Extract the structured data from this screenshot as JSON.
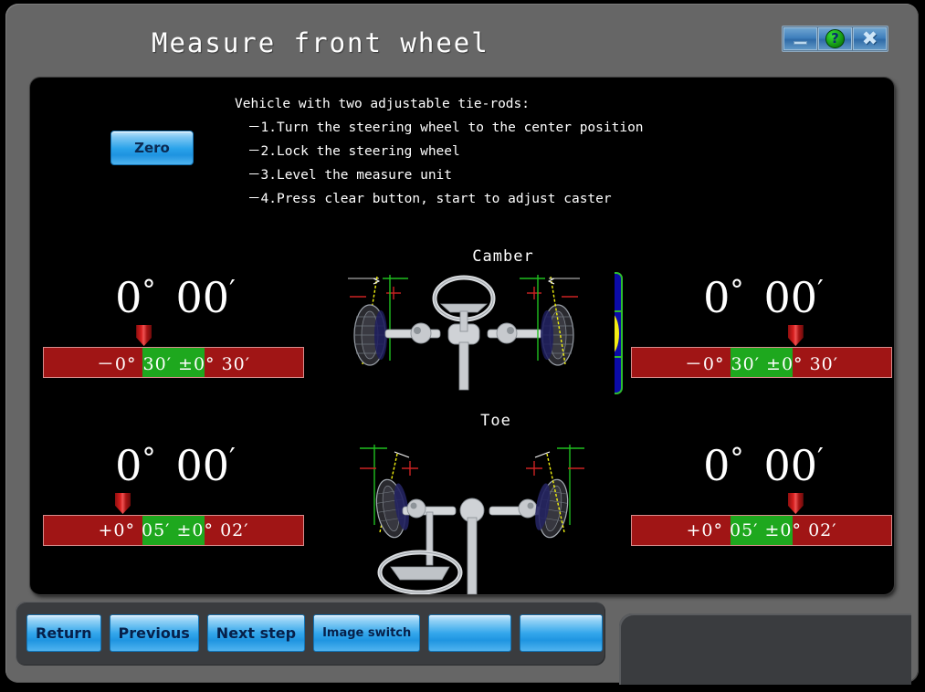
{
  "window": {
    "title": "Measure front wheel",
    "controls": [
      {
        "name": "minimize-button",
        "glyph": "minimize"
      },
      {
        "name": "help-button",
        "glyph": "?"
      },
      {
        "name": "close-button",
        "glyph": "✖"
      }
    ]
  },
  "instructions": {
    "heading": "Vehicle with two adjustable tie-rods:",
    "steps": [
      "－1.Turn the steering wheel to the center position",
      "－2.Lock the steering wheel",
      "－3.Level the measure unit",
      "－4.Press clear button, start to adjust caster"
    ]
  },
  "zero_button": {
    "label": "Zero"
  },
  "sections": {
    "camber_label": "Camber",
    "toe_label": "Toe"
  },
  "readouts": {
    "camber_left": {
      "degrees": "0",
      "deg_symbol": "°",
      "minutes": "00",
      "min_symbol": "′",
      "spec_text": "－0° 30′ ±0° 30′",
      "green_left_pct": 38,
      "green_width_pct": 24,
      "pointer_pct": 38
    },
    "camber_right": {
      "degrees": "0",
      "deg_symbol": "°",
      "minutes": "00",
      "min_symbol": "′",
      "spec_text": "－0° 30′ ±0° 30′",
      "green_left_pct": 38,
      "green_width_pct": 24,
      "pointer_pct": 62
    },
    "toe_left": {
      "degrees": "0",
      "deg_symbol": "°",
      "minutes": "00",
      "min_symbol": "′",
      "spec_text": "+0° 05′ ±0° 02′",
      "green_left_pct": 38,
      "green_width_pct": 24,
      "pointer_pct": 30
    },
    "toe_right": {
      "degrees": "0",
      "deg_symbol": "°",
      "minutes": "00",
      "min_symbol": "′",
      "spec_text": "+0° 05′ ±0° 02′",
      "green_left_pct": 38,
      "green_width_pct": 24,
      "pointer_pct": 62
    }
  },
  "level_indicators": {
    "left": {
      "name": "left-level-bubble"
    },
    "right": {
      "name": "right-level-bubble"
    }
  },
  "toolbar": {
    "buttons": [
      {
        "label": "Return",
        "name": "return-button"
      },
      {
        "label": "Previous",
        "name": "previous-button"
      },
      {
        "label": "Next step",
        "name": "next-step-button"
      },
      {
        "label": "Image switch",
        "name": "image-switch-button"
      },
      {
        "label": "",
        "name": "spare-button-1"
      },
      {
        "label": "",
        "name": "spare-button-2"
      }
    ]
  },
  "colors": {
    "window_gray": "#666666",
    "screen_black": "#000000",
    "gauge_red": "#a01515",
    "gauge_green": "#1ea81e",
    "button_blue": "#2aa3ea",
    "bubble_yellow": "#f2ec14",
    "indicator_blue": "#0b0ba8"
  }
}
